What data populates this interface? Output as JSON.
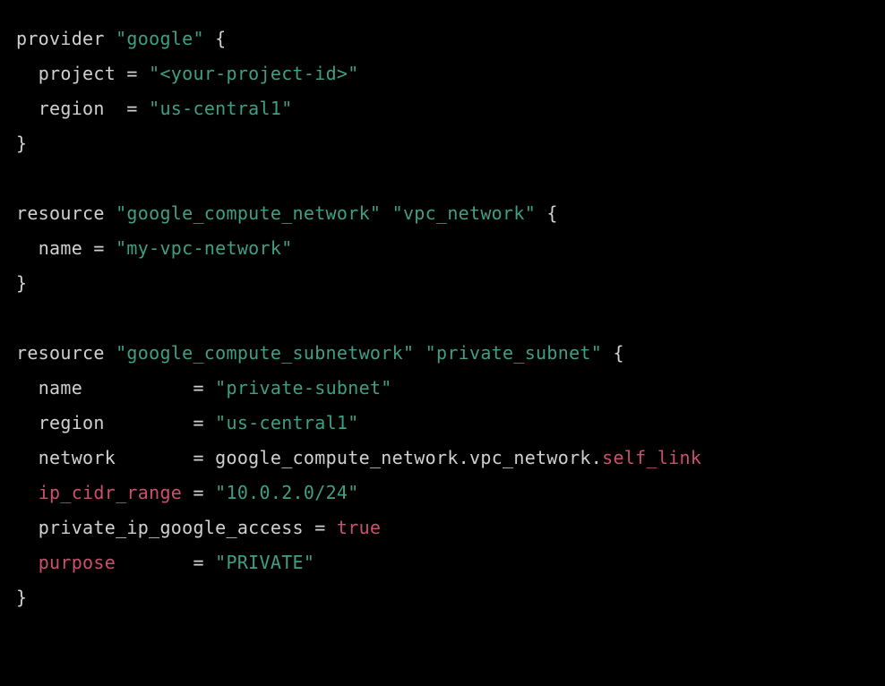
{
  "code": {
    "line1": {
      "kw": "provider",
      "str": "\"google\"",
      "brace": "{"
    },
    "line2": {
      "attr": "project",
      "eq": "=",
      "val": "\"<your-project-id>\""
    },
    "line3": {
      "attr": "region",
      "eq": "=",
      "val": "\"us-central1\""
    },
    "line4": {
      "brace": "}"
    },
    "line5": "",
    "line6": {
      "kw": "resource",
      "type": "\"google_compute_network\"",
      "name": "\"vpc_network\"",
      "brace": "{"
    },
    "line7": {
      "attr": "name",
      "eq": "=",
      "val": "\"my-vpc-network\""
    },
    "line8": {
      "brace": "}"
    },
    "line9": "",
    "line10": {
      "kw": "resource",
      "type": "\"google_compute_subnetwork\"",
      "name": "\"private_subnet\"",
      "brace": "{"
    },
    "line11": {
      "attr": "name",
      "eq": "=",
      "val": "\"private-subnet\""
    },
    "line12": {
      "attr": "region",
      "eq": "=",
      "val": "\"us-central1\""
    },
    "line13": {
      "attr": "network",
      "eq": "=",
      "ref1": "google_compute_network",
      "dot1": ".",
      "ref2": "vpc_network",
      "dot2": ".",
      "ref3": "self_link"
    },
    "line14": {
      "attr": "ip_cidr_range",
      "eq": "=",
      "val": "\"10.0.2.0/24\""
    },
    "line15": {
      "attr": "private_ip_google_access",
      "eq": "=",
      "val": "true"
    },
    "line16": {
      "attr": "purpose",
      "eq": "=",
      "val": "\"PRIVATE\""
    },
    "line17": {
      "brace": "}"
    }
  }
}
